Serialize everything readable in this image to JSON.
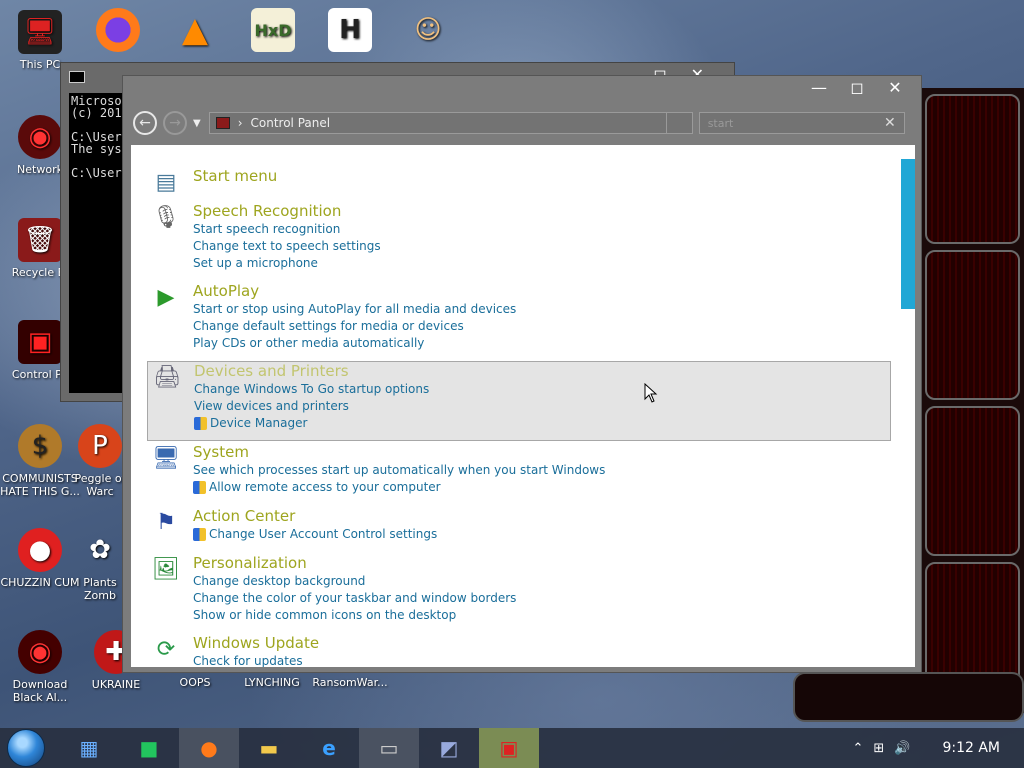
{
  "desktop": {
    "icons": [
      {
        "label": "This PC",
        "glyph": "computer-icon"
      },
      {
        "label": "Network",
        "glyph": "network-icon"
      },
      {
        "label": "Recycle Bi",
        "glyph": "recycle-bin-icon"
      },
      {
        "label": "Control Pa",
        "glyph": "control-panel-icon"
      },
      {
        "label": "COMMUNISTS HATE THIS G...",
        "glyph": "money-bag-icon"
      },
      {
        "label": "Peggle of Warc",
        "glyph": "peggle-icon"
      },
      {
        "label": "CHUZZIN CUM",
        "glyph": "chuzzle-icon"
      },
      {
        "label": "Plants Zomb",
        "glyph": "flower-icon"
      },
      {
        "label": "Download Black Al...",
        "glyph": "alienware-icon"
      },
      {
        "label": "UKRAINE",
        "glyph": "ukraine-icon"
      },
      {
        "label": "OOPS",
        "glyph": "oops-icon"
      },
      {
        "label": "LYNCHING",
        "glyph": "lynching-icon"
      },
      {
        "label": "RansomWar...",
        "glyph": "ransomware-icon"
      }
    ]
  },
  "console": {
    "lines": [
      "Microso",
      "(c) 201",
      "",
      "C:\\User",
      "The sys",
      "",
      "C:\\User"
    ]
  },
  "control_panel": {
    "breadcrumb_root": "Control Panel",
    "search_placeholder": "start",
    "items": [
      {
        "heading": "Start menu",
        "links": []
      },
      {
        "heading": "Speech Recognition",
        "links": [
          "Start speech recognition",
          "Change text to speech settings",
          "Set up a microphone"
        ]
      },
      {
        "heading": "AutoPlay",
        "links": [
          "Start or stop using AutoPlay for all media and devices",
          "Change default settings for media or devices",
          "Play CDs or other media automatically"
        ]
      },
      {
        "heading": "Devices and Printers",
        "links": [
          "Change Windows To Go startup options",
          "View devices and printers",
          "Device Manager"
        ]
      },
      {
        "heading": "System",
        "links": [
          "See which processes start up automatically when you start Windows",
          "Allow remote access to your computer"
        ]
      },
      {
        "heading": "Action Center",
        "links": [
          "Change User Account Control settings"
        ]
      },
      {
        "heading": "Personalization",
        "links": [
          "Change desktop background",
          "Change the color of your taskbar and window borders",
          "Show or hide common icons on the desktop"
        ]
      },
      {
        "heading": "Windows Update",
        "links": [
          "Check for updates"
        ]
      }
    ]
  },
  "taskbar": {
    "clock": "9:12 AM"
  }
}
